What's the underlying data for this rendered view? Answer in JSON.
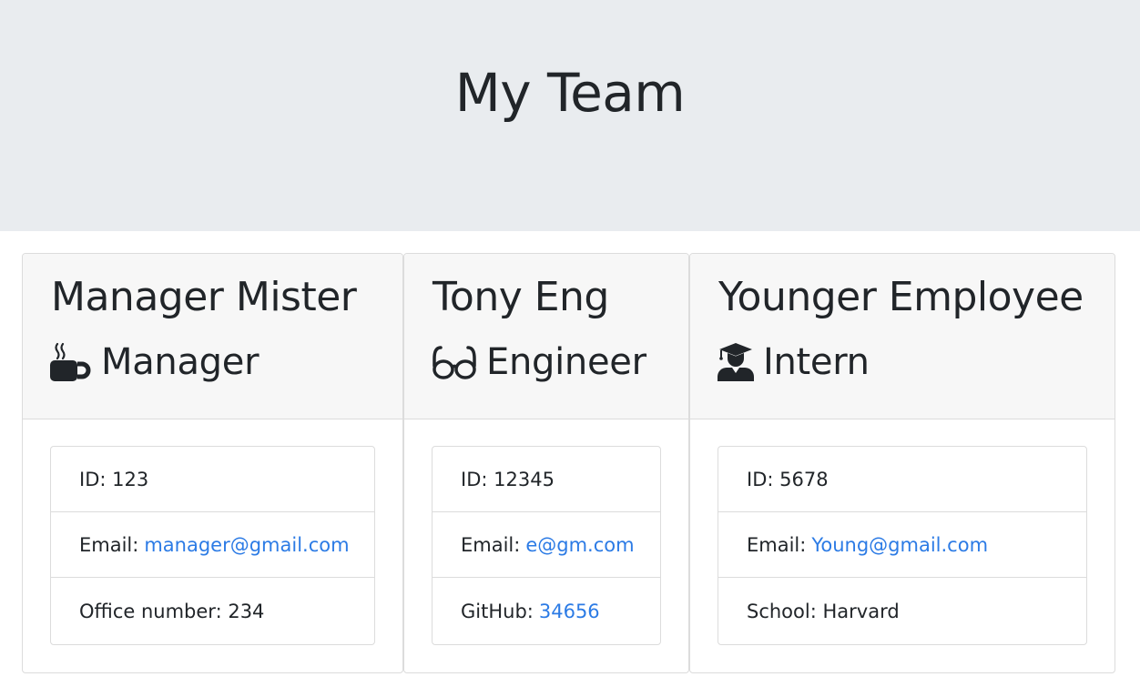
{
  "header": {
    "title": "My Team"
  },
  "team": [
    {
      "name": "Manager Mister",
      "role": "Manager",
      "role_icon": "coffee-icon",
      "id_label": "ID:",
      "id": "123",
      "email_label": "Email:",
      "email": "manager@gmail.com",
      "extra_label": "Office number:",
      "extra_value": "234"
    },
    {
      "name": "Tony Eng",
      "role": "Engineer",
      "role_icon": "glasses-icon",
      "id_label": "ID:",
      "id": "12345",
      "email_label": "Email:",
      "email": "e@gm.com",
      "extra_label": "GitHub:",
      "extra_value": "34656"
    },
    {
      "name": "Younger Employee",
      "role": "Intern",
      "role_icon": "graduate-icon",
      "id_label": "ID:",
      "id": "5678",
      "email_label": "Email:",
      "email": "Young@gmail.com",
      "extra_label": "School:",
      "extra_value": "Harvard"
    }
  ],
  "colors": {
    "jumbotron_bg": "#e9ecef",
    "card_header_bg": "#f7f7f7",
    "link": "#2c7be5",
    "text": "#212529"
  }
}
